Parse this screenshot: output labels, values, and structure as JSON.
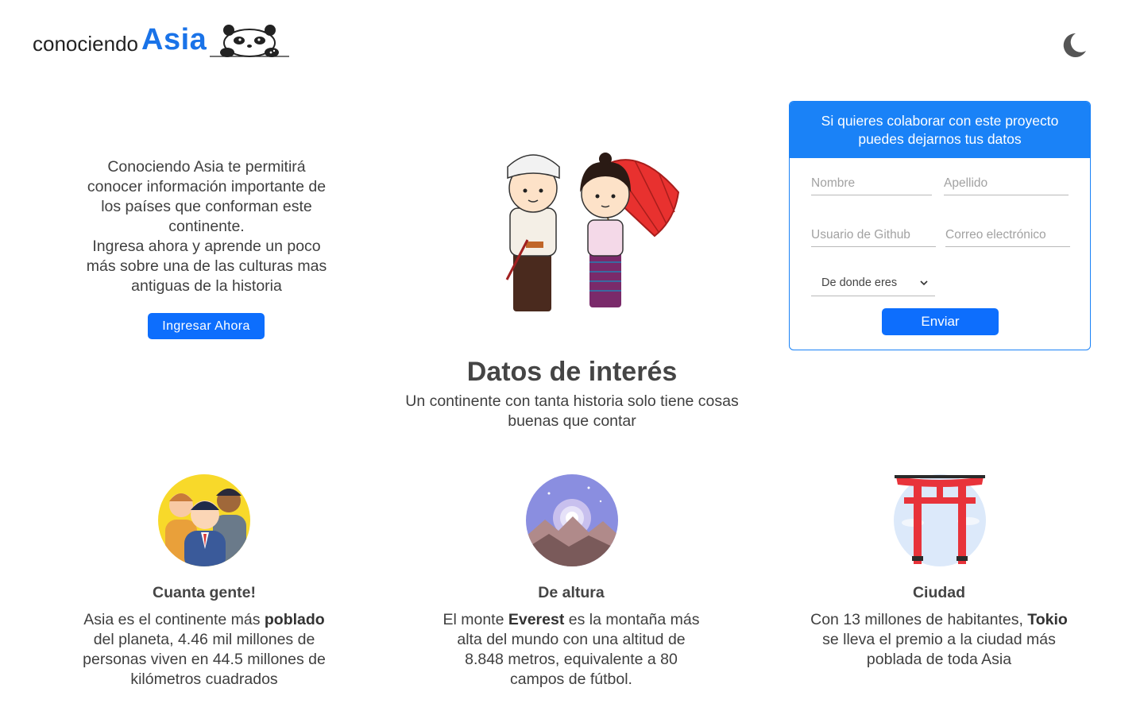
{
  "brand": {
    "prefix": "conociendo",
    "name": "Asia"
  },
  "theme_toggle": {
    "icon": "moon-icon"
  },
  "intro": {
    "paragraph1": "Conociendo Asia te permitirá conocer información importante de los países que conforman este continente.",
    "paragraph2": "Ingresa ahora y aprende un poco más sobre una de las culturas mas antiguas de la historia",
    "button": "Ingresar Ahora"
  },
  "form": {
    "header": "Si quieres colaborar con este proyecto puedes dejarnos tus datos",
    "nombre_placeholder": "Nombre",
    "apellido_placeholder": "Apellido",
    "usuario_placeholder": "Usuario de Github",
    "correo_placeholder": "Correo electrónico",
    "select_value": "De donde eres",
    "submit": "Enviar"
  },
  "datos": {
    "title": "Datos de interés",
    "subtitle": "Un continente con tanta historia solo tiene cosas buenas que contar"
  },
  "facts": [
    {
      "title": "Cuanta gente!",
      "text_before": "Asia es el continente más ",
      "bold": "poblado",
      "text_after": " del planeta, 4.46 mil millones de personas viven en 44.5 millones de kilómetros cuadrados"
    },
    {
      "title": "De altura",
      "text_before": "El monte ",
      "bold": "Everest",
      "text_after": " es la montaña más alta del mundo con una altitud de 8.848 metros, equivalente a 80 campos de fútbol."
    },
    {
      "title": "Ciudad",
      "text_before": "Con 13 millones de habitantes, ",
      "bold": "Tokio",
      "text_after": " se lleva el premio a la ciudad más poblada de toda Asia"
    }
  ],
  "colors": {
    "accent": "#1a82f7",
    "button": "#0d6efd",
    "text": "#3f3f3f"
  }
}
